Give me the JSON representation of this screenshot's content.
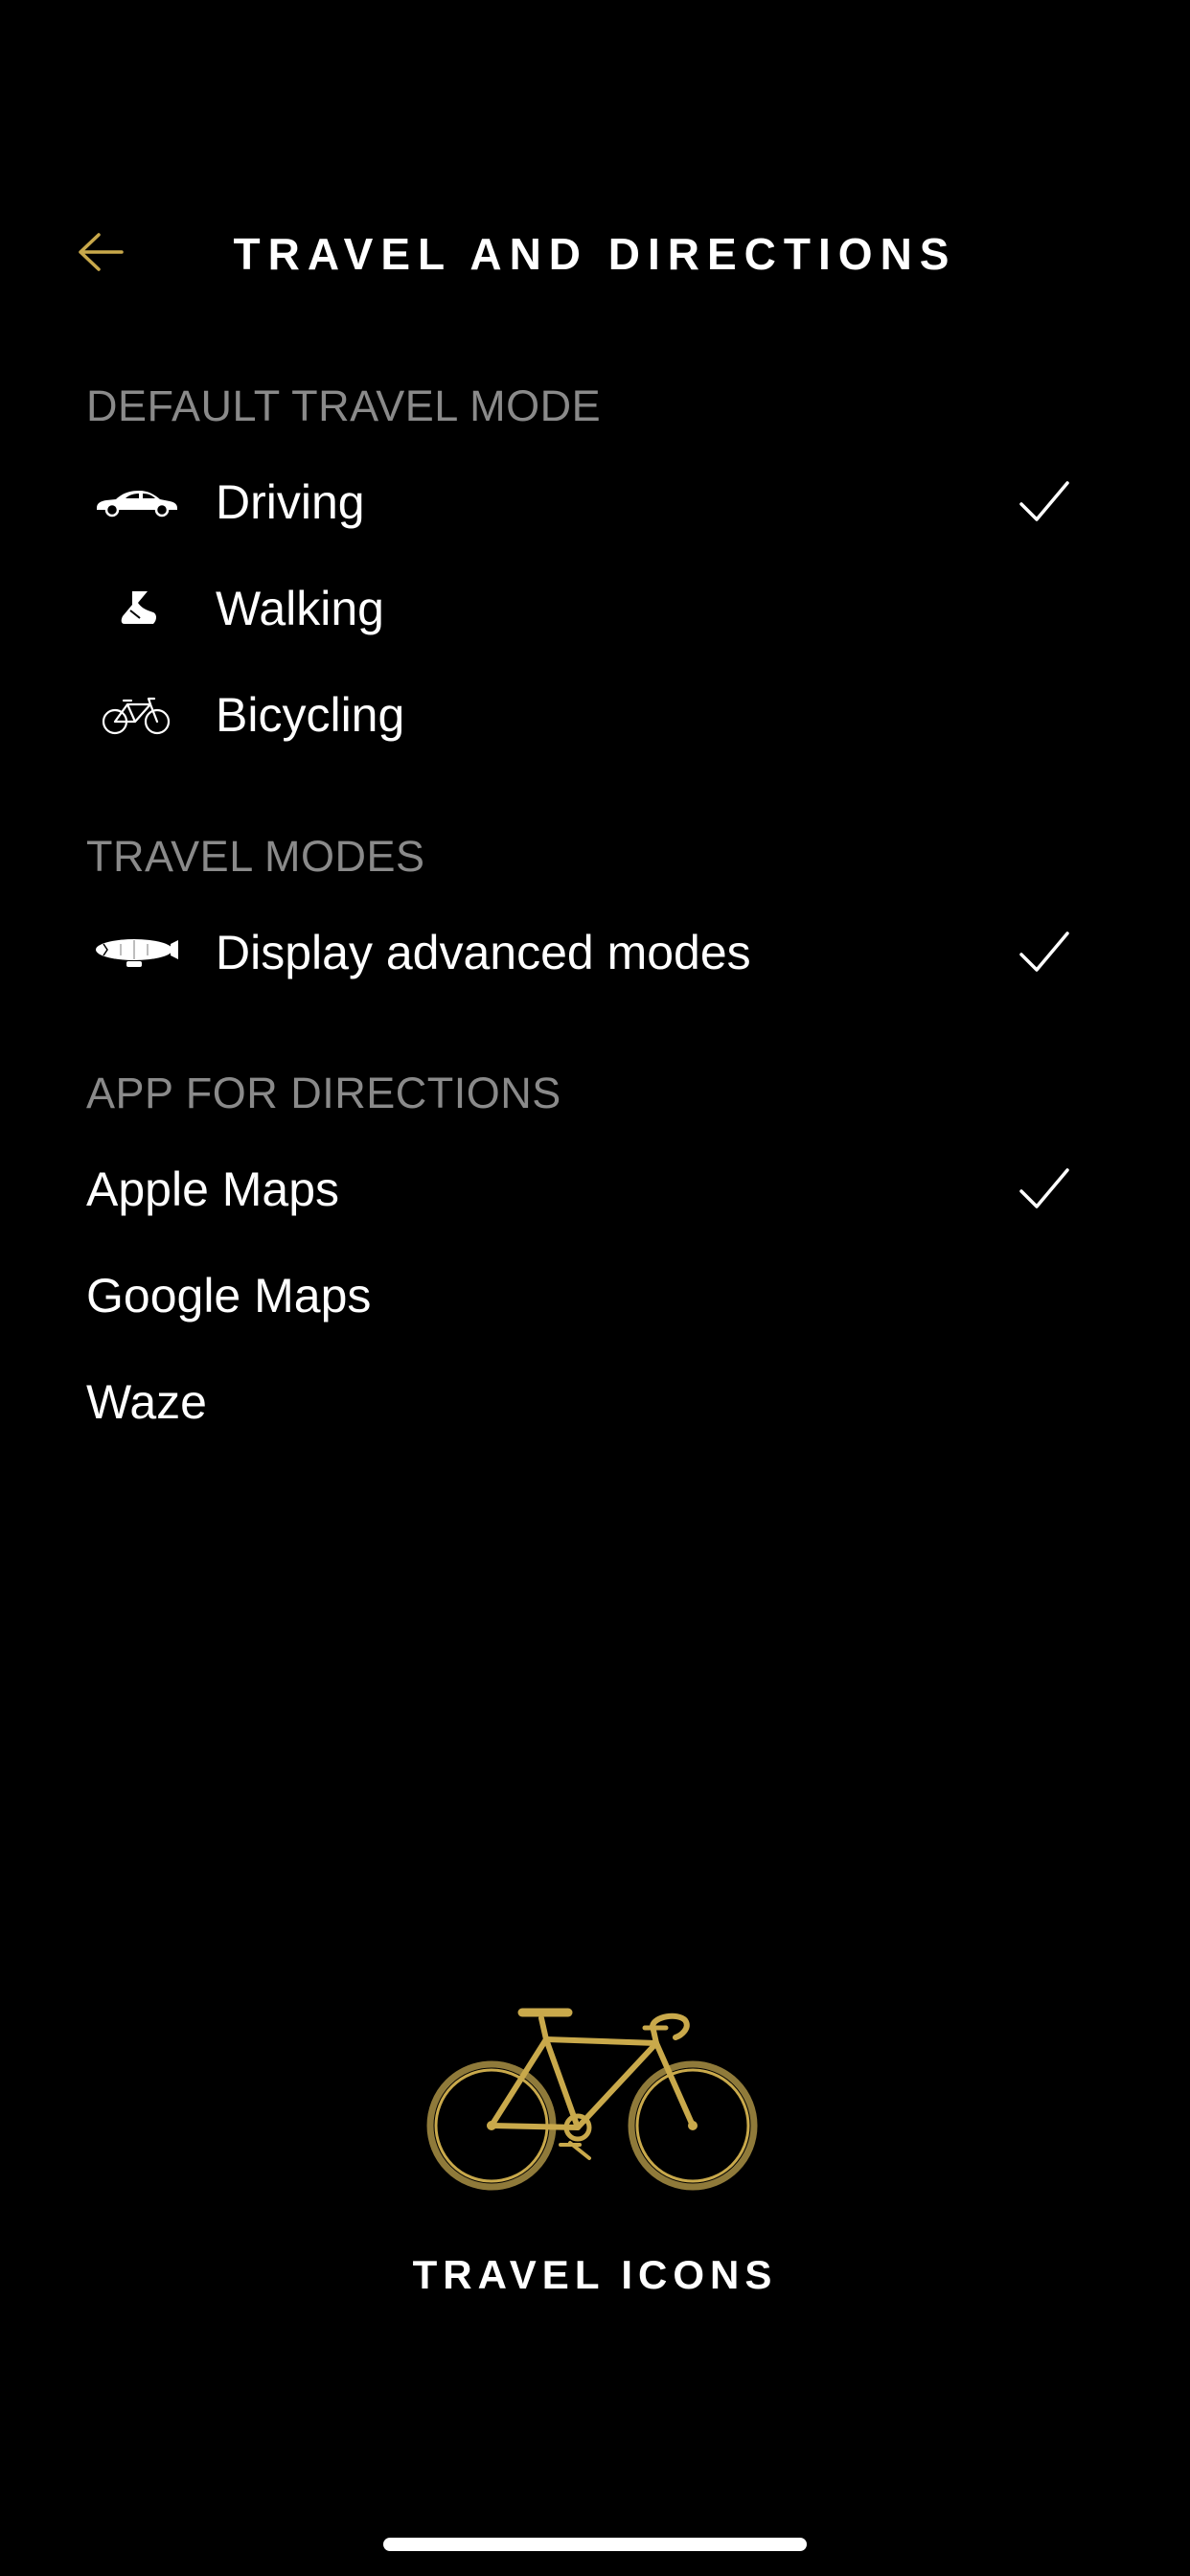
{
  "colors": {
    "background": "#000000",
    "accent_gold": "#c9a94b",
    "section_gray": "#8a8a8a",
    "text": "#ffffff"
  },
  "header": {
    "title": "TRAVEL AND DIRECTIONS",
    "back_icon": "arrow-left-icon"
  },
  "sections": {
    "default_travel_mode": {
      "title": "DEFAULT TRAVEL MODE",
      "items": [
        {
          "label": "Driving",
          "icon": "car-icon",
          "selected": true
        },
        {
          "label": "Walking",
          "icon": "shoe-icon",
          "selected": false
        },
        {
          "label": "Bicycling",
          "icon": "bicycle-icon",
          "selected": false
        }
      ]
    },
    "travel_modes": {
      "title": "TRAVEL MODES",
      "items": [
        {
          "label": "Display advanced modes",
          "icon": "airship-icon",
          "selected": true
        }
      ]
    },
    "app_for_directions": {
      "title": "APP FOR DIRECTIONS",
      "items": [
        {
          "label": "Apple Maps",
          "selected": true
        },
        {
          "label": "Google Maps",
          "selected": false
        },
        {
          "label": "Waze",
          "selected": false
        }
      ]
    }
  },
  "footer": {
    "illustration": "gold-bicycle-icon",
    "title": "TRAVEL ICONS"
  }
}
